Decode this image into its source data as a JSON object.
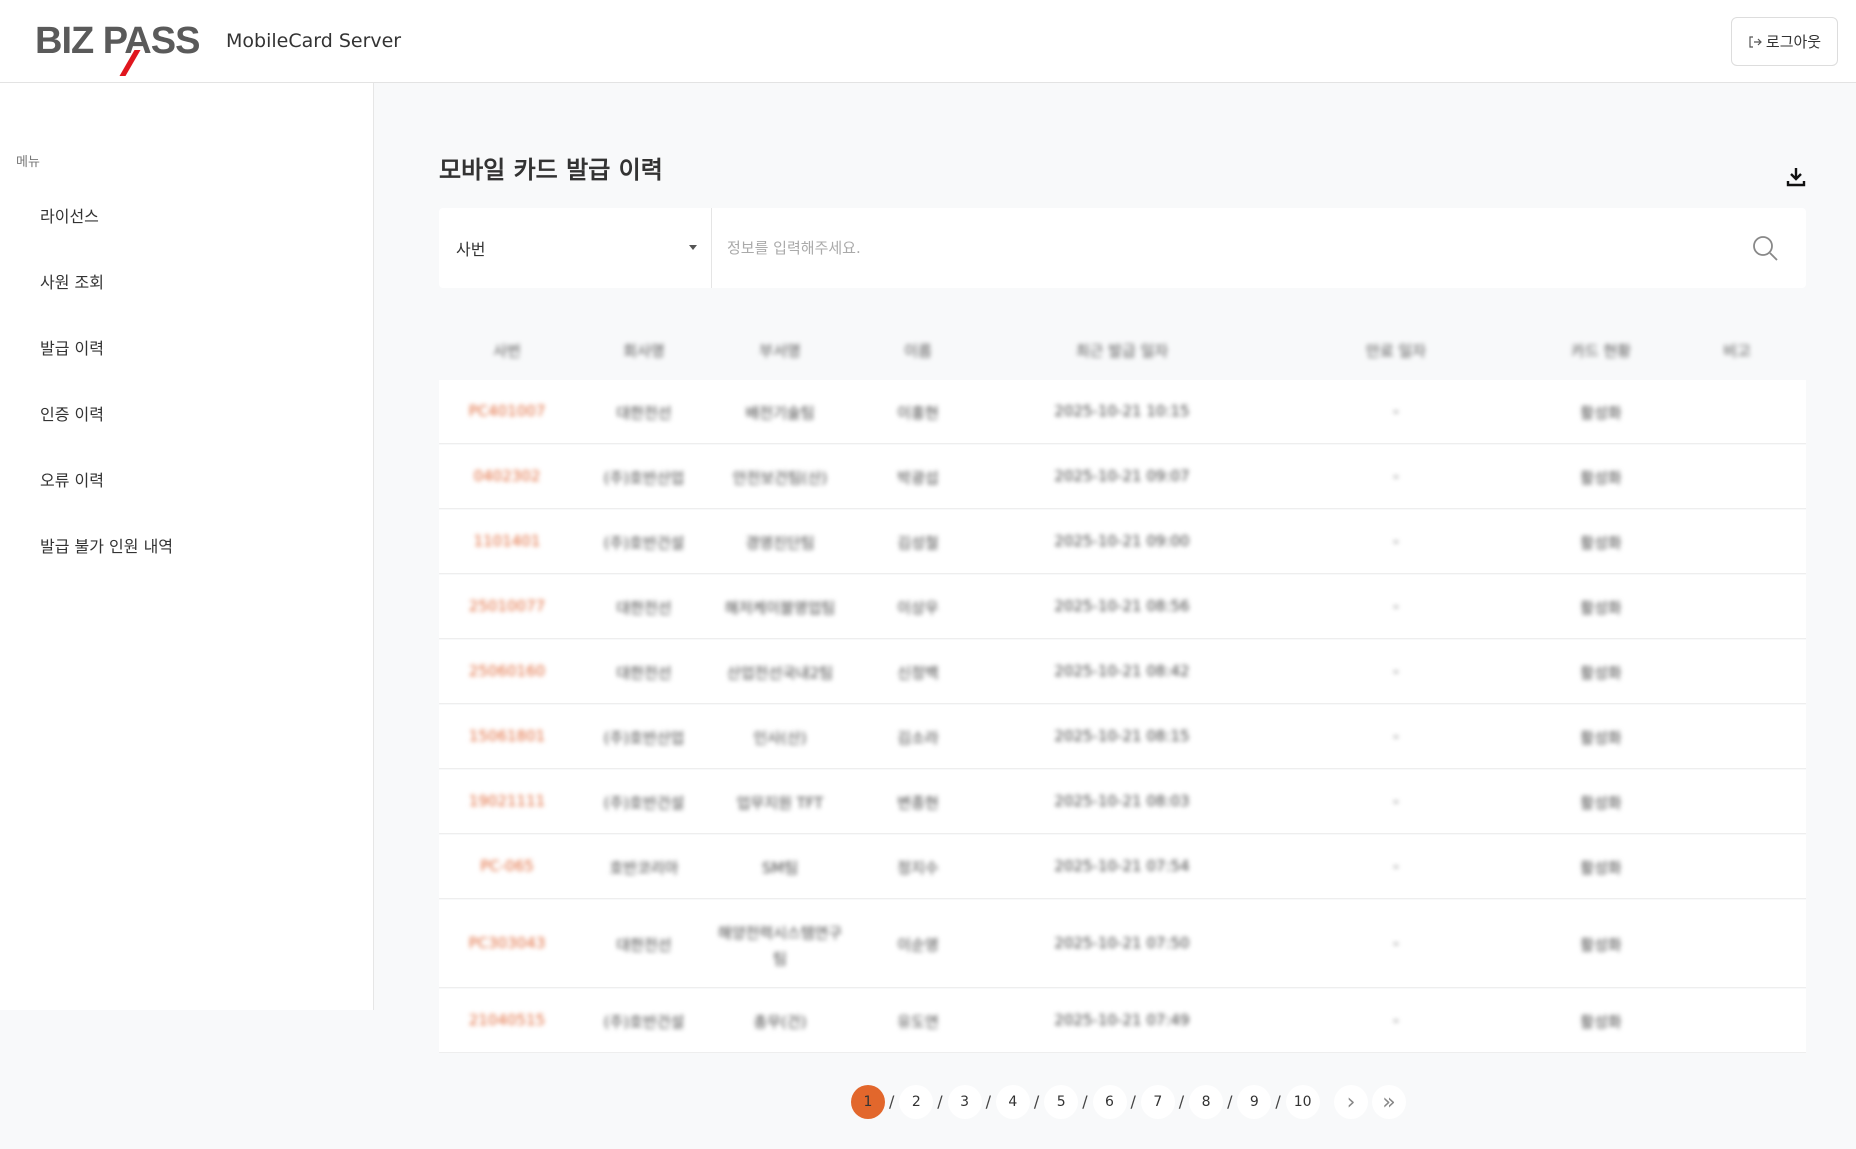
{
  "header": {
    "logo": "BIZ PASS",
    "app_title": "MobileCard Server",
    "logout": "로그아웃"
  },
  "sidebar": {
    "menu_label": "메뉴",
    "items": [
      {
        "label": "라이선스"
      },
      {
        "label": "사원 조회"
      },
      {
        "label": "발급 이력"
      },
      {
        "label": "인증 이력"
      },
      {
        "label": "오류 이력"
      },
      {
        "label": "발급 불가 인원 내역"
      }
    ]
  },
  "main": {
    "title": "모바일 카드 발급 이력",
    "search": {
      "field": "사번",
      "placeholder": "정보를 입력해주세요."
    },
    "columns": [
      "사번",
      "회사명",
      "부서명",
      "이름",
      "최근 발급 일자",
      "만료 일자",
      "카드 현황",
      "비고"
    ],
    "rows": [
      [
        "PC401007",
        "대한전선",
        "배전기술팀",
        "이홍현",
        "2025-10-21 10:15",
        "-",
        "활성화",
        ""
      ],
      [
        "0402302",
        "(주)호반산업",
        "안전보건팀(산)",
        "박광섭",
        "2025-10-21 09:07",
        "-",
        "활성화",
        ""
      ],
      [
        "1101401",
        "(주)호반건설",
        "경영진단팀",
        "김성철",
        "2025-10-21 09:00",
        "-",
        "활성화",
        ""
      ],
      [
        "25010077",
        "대한전선",
        "해저케이블영업팀",
        "이상우",
        "2025-10-21 08:56",
        "-",
        "활성화",
        ""
      ],
      [
        "25060160",
        "대한전선",
        "산업전선국내2팀",
        "신정백",
        "2025-10-21 08:42",
        "-",
        "활성화",
        ""
      ],
      [
        "15061801",
        "(주)호반산업",
        "인사(산)",
        "김소라",
        "2025-10-21 08:15",
        "-",
        "활성화",
        ""
      ],
      [
        "19021111",
        "(주)호반건설",
        "업무지원 TFT",
        "변종현",
        "2025-10-21 08:03",
        "-",
        "활성화",
        ""
      ],
      [
        "PC-065",
        "호반코리아",
        "SM팀",
        "정지수",
        "2025-10-21 07:54",
        "-",
        "활성화",
        ""
      ],
      [
        "PC303043",
        "대한전선",
        "해양전력시스템연구팀",
        "이순영",
        "2025-10-21 07:50",
        "-",
        "활성화",
        ""
      ],
      [
        "21040515",
        "(주)호반건설",
        "총무(건)",
        "유도연",
        "2025-10-21 07:49",
        "-",
        "활성화",
        ""
      ]
    ]
  },
  "pagination": {
    "pages": [
      "1",
      "2",
      "3",
      "4",
      "5",
      "6",
      "7",
      "8",
      "9",
      "10"
    ],
    "current": "1",
    "separator": "/"
  }
}
